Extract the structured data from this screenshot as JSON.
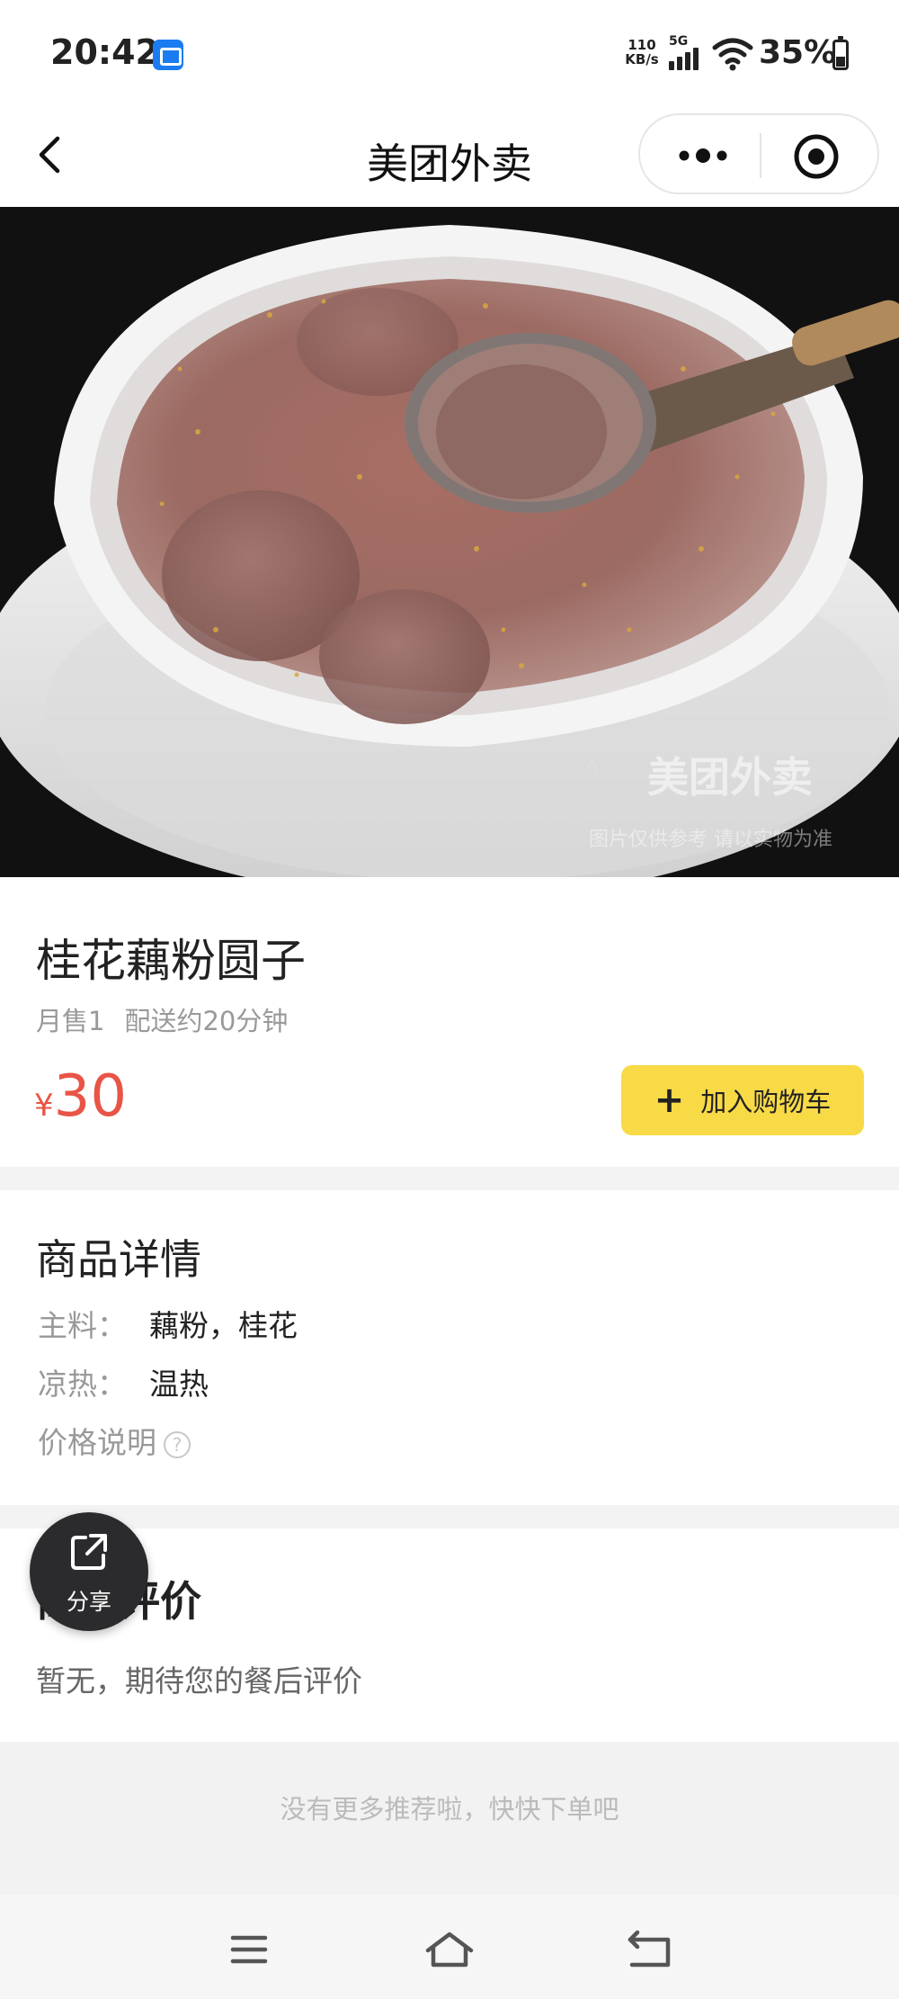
{
  "status_bar": {
    "time": "20:42",
    "net_speed_value": "110",
    "net_speed_unit": "KB/s",
    "network": "5G",
    "battery": "35%",
    "battery_level": 0.35,
    "app_icon": "meituan-app-icon"
  },
  "nav": {
    "title": "美团外卖",
    "back_icon": "chevron-left-icon",
    "more_icon": "more-dots-icon",
    "close_icon": "target-circle-icon"
  },
  "hero": {
    "watermark_brand": "美团外卖",
    "watermark_note": "图片仅供参考 请以实物为准"
  },
  "product": {
    "name": "桂花藕粉圆子",
    "monthly_sales": "月售1",
    "delivery_time": "配送约20分钟",
    "currency": "¥",
    "price": "30",
    "add_to_cart": "加入购物车",
    "price_color": "#e85446",
    "cart_button_color": "#f8da47"
  },
  "details": {
    "title": "商品详情",
    "rows": [
      {
        "key": "主料：",
        "value": "藕粉，桂花"
      },
      {
        "key": "凉热：",
        "value": "温热"
      }
    ],
    "price_note": "价格说明",
    "price_note_icon": "question-circle-icon"
  },
  "reviews": {
    "title": "商品评价",
    "empty_text": "暂无，期待您的餐后评价"
  },
  "share": {
    "label": "分享",
    "icon": "share-external-icon"
  },
  "footer": {
    "text": "没有更多推荐啦，快快下单吧"
  },
  "system_nav": {
    "menu_icon": "menu-lines-icon",
    "home_icon": "home-outline-icon",
    "back_icon": "return-arrow-icon"
  }
}
